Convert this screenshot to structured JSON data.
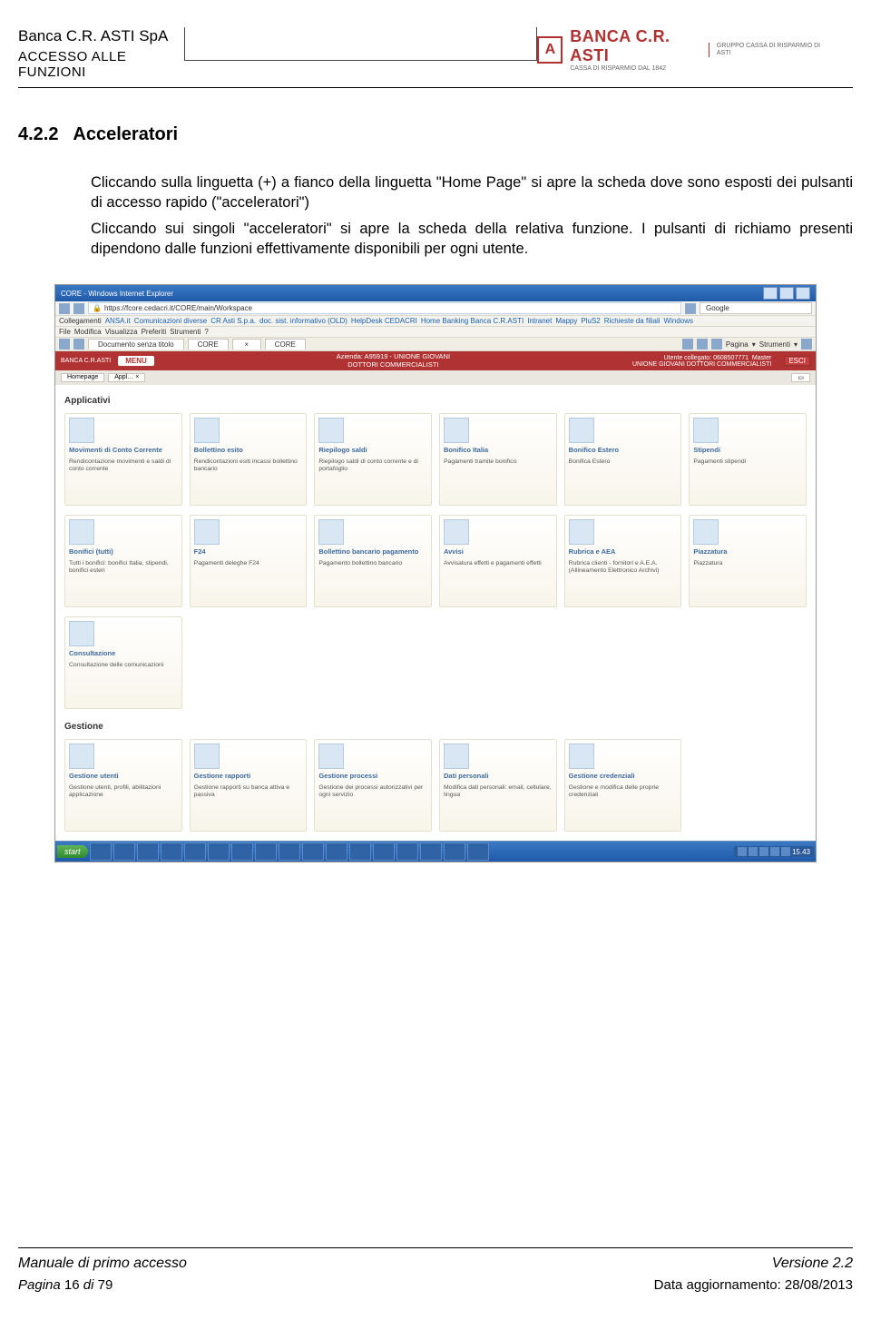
{
  "header": {
    "company": "Banca C.R. ASTI SpA",
    "subtitle": "ACCESSO ALLE FUNZIONI",
    "logo_main": "BANCA C.R. ASTI",
    "logo_sub": "CASSA DI RISPARMIO DAL 1842",
    "logo_right": "GRUPPO CASSA DI RISPARMIO DI ASTI"
  },
  "section": {
    "number": "4.2.2",
    "title": "Acceleratori",
    "para1": "Cliccando sulla linguetta (+) a fianco della linguetta \"Home Page\" si apre la scheda dove sono esposti  dei pulsanti di accesso rapido (\"acceleratori\")",
    "para2": "Cliccando sui singoli \"acceleratori\" si apre la scheda della relativa funzione. I pulsanti di richiamo presenti  dipendono dalle funzioni effettivamente disponibili per ogni utente."
  },
  "shot": {
    "title": "CORE - Windows Internet Explorer",
    "url": "https://fcore.cedacri.it/CORE/main/Workspace",
    "search": "Google",
    "links_label": "Collegamenti",
    "links": [
      "ANSA.it",
      "Comunicazioni diverse",
      "CR Asti S.p.a.",
      "doc. sist. informativo (OLD)",
      "HelpDesk CEDACRI",
      "Home Banking Banca C.R.ASTI",
      "Intranet",
      "Mappy",
      "PluS2",
      "Richieste da filiali",
      "Windows"
    ],
    "menubar": [
      "File",
      "Modifica",
      "Visualizza",
      "Preferiti",
      "Strumenti",
      "?"
    ],
    "doc": "Documento senza titolo",
    "core": "CORE",
    "toolbar": [
      "Pagina",
      "Strumenti"
    ],
    "bank": "BANCA C.R.ASTI",
    "menu": "MENU",
    "azienda": "Azienda: A95919 - UNIONE GIOVANI",
    "azienda2": "DOTTORI COMMERCIALISTI",
    "utente": "Utente collegato: 0608507771",
    "master": "Master",
    "utente2": "UNIONE GIOVANI DOTTORI COMMERCIALISTI",
    "esci": "ESCI",
    "tab_home": "Homepage",
    "tab_appl": "Appl…",
    "sec1": "Applicativi",
    "apps": [
      {
        "t": "Movimenti di Conto Corrente",
        "d": "Rendicontazione movimenti e saldi di conto corrente"
      },
      {
        "t": "Bollettino esito",
        "d": "Rendicontazioni esiti incassi bollettino bancario"
      },
      {
        "t": "Riepilogo saldi",
        "d": "Riepilogo saldi di conto corrente e di portafoglio"
      },
      {
        "t": "Bonifico Italia",
        "d": "Pagamenti tramite bonifico"
      },
      {
        "t": "Bonifico Estero",
        "d": "Bonifica Estero"
      },
      {
        "t": "Stipendi",
        "d": "Pagamenti stipendi"
      },
      {
        "t": "Bonifici (tutti)",
        "d": "Tutti i bonifici: bonifici Italia, stipendi, bonifici esteri"
      },
      {
        "t": "F24",
        "d": "Pagamenti deleghe F24"
      },
      {
        "t": "Bollettino bancario pagamento",
        "d": "Pagamento bollettino bancario"
      },
      {
        "t": "Avvisi",
        "d": "Avvisatura effetti e pagamenti effetti"
      },
      {
        "t": "Rubrica e AEA",
        "d": "Rubrica clienti - fornitori e A.E.A. (Allineamento Elettronico Archivi)"
      },
      {
        "t": "Piazzatura",
        "d": "Piazzatura"
      },
      {
        "t": "Consultazione",
        "d": "Consultazione delle comunicazioni"
      }
    ],
    "sec2": "Gestione",
    "gest": [
      {
        "t": "Gestione utenti",
        "d": "Gestione utenti, profili, abilitazioni applicazione"
      },
      {
        "t": "Gestione rapporti",
        "d": "Gestione rapporti su banca attiva e passiva"
      },
      {
        "t": "Gestione processi",
        "d": "Gestione dei processi autorizzativi per ogni servizio"
      },
      {
        "t": "Dati personali",
        "d": "Modifica dati personali: email, cellulare, lingua"
      },
      {
        "t": "Gestione credenziali",
        "d": "Gestione e modifica delle proprie credenziali"
      }
    ],
    "start": "start",
    "clock": "15.43"
  },
  "footer": {
    "manual": "Manuale di primo accesso",
    "version": "Versione 2.2",
    "page_lbl": "Pagina",
    "page_cur": "16",
    "page_of": "di",
    "page_tot": "79",
    "date_lbl": "Data aggiornamento:",
    "date": "28/08/2013"
  }
}
